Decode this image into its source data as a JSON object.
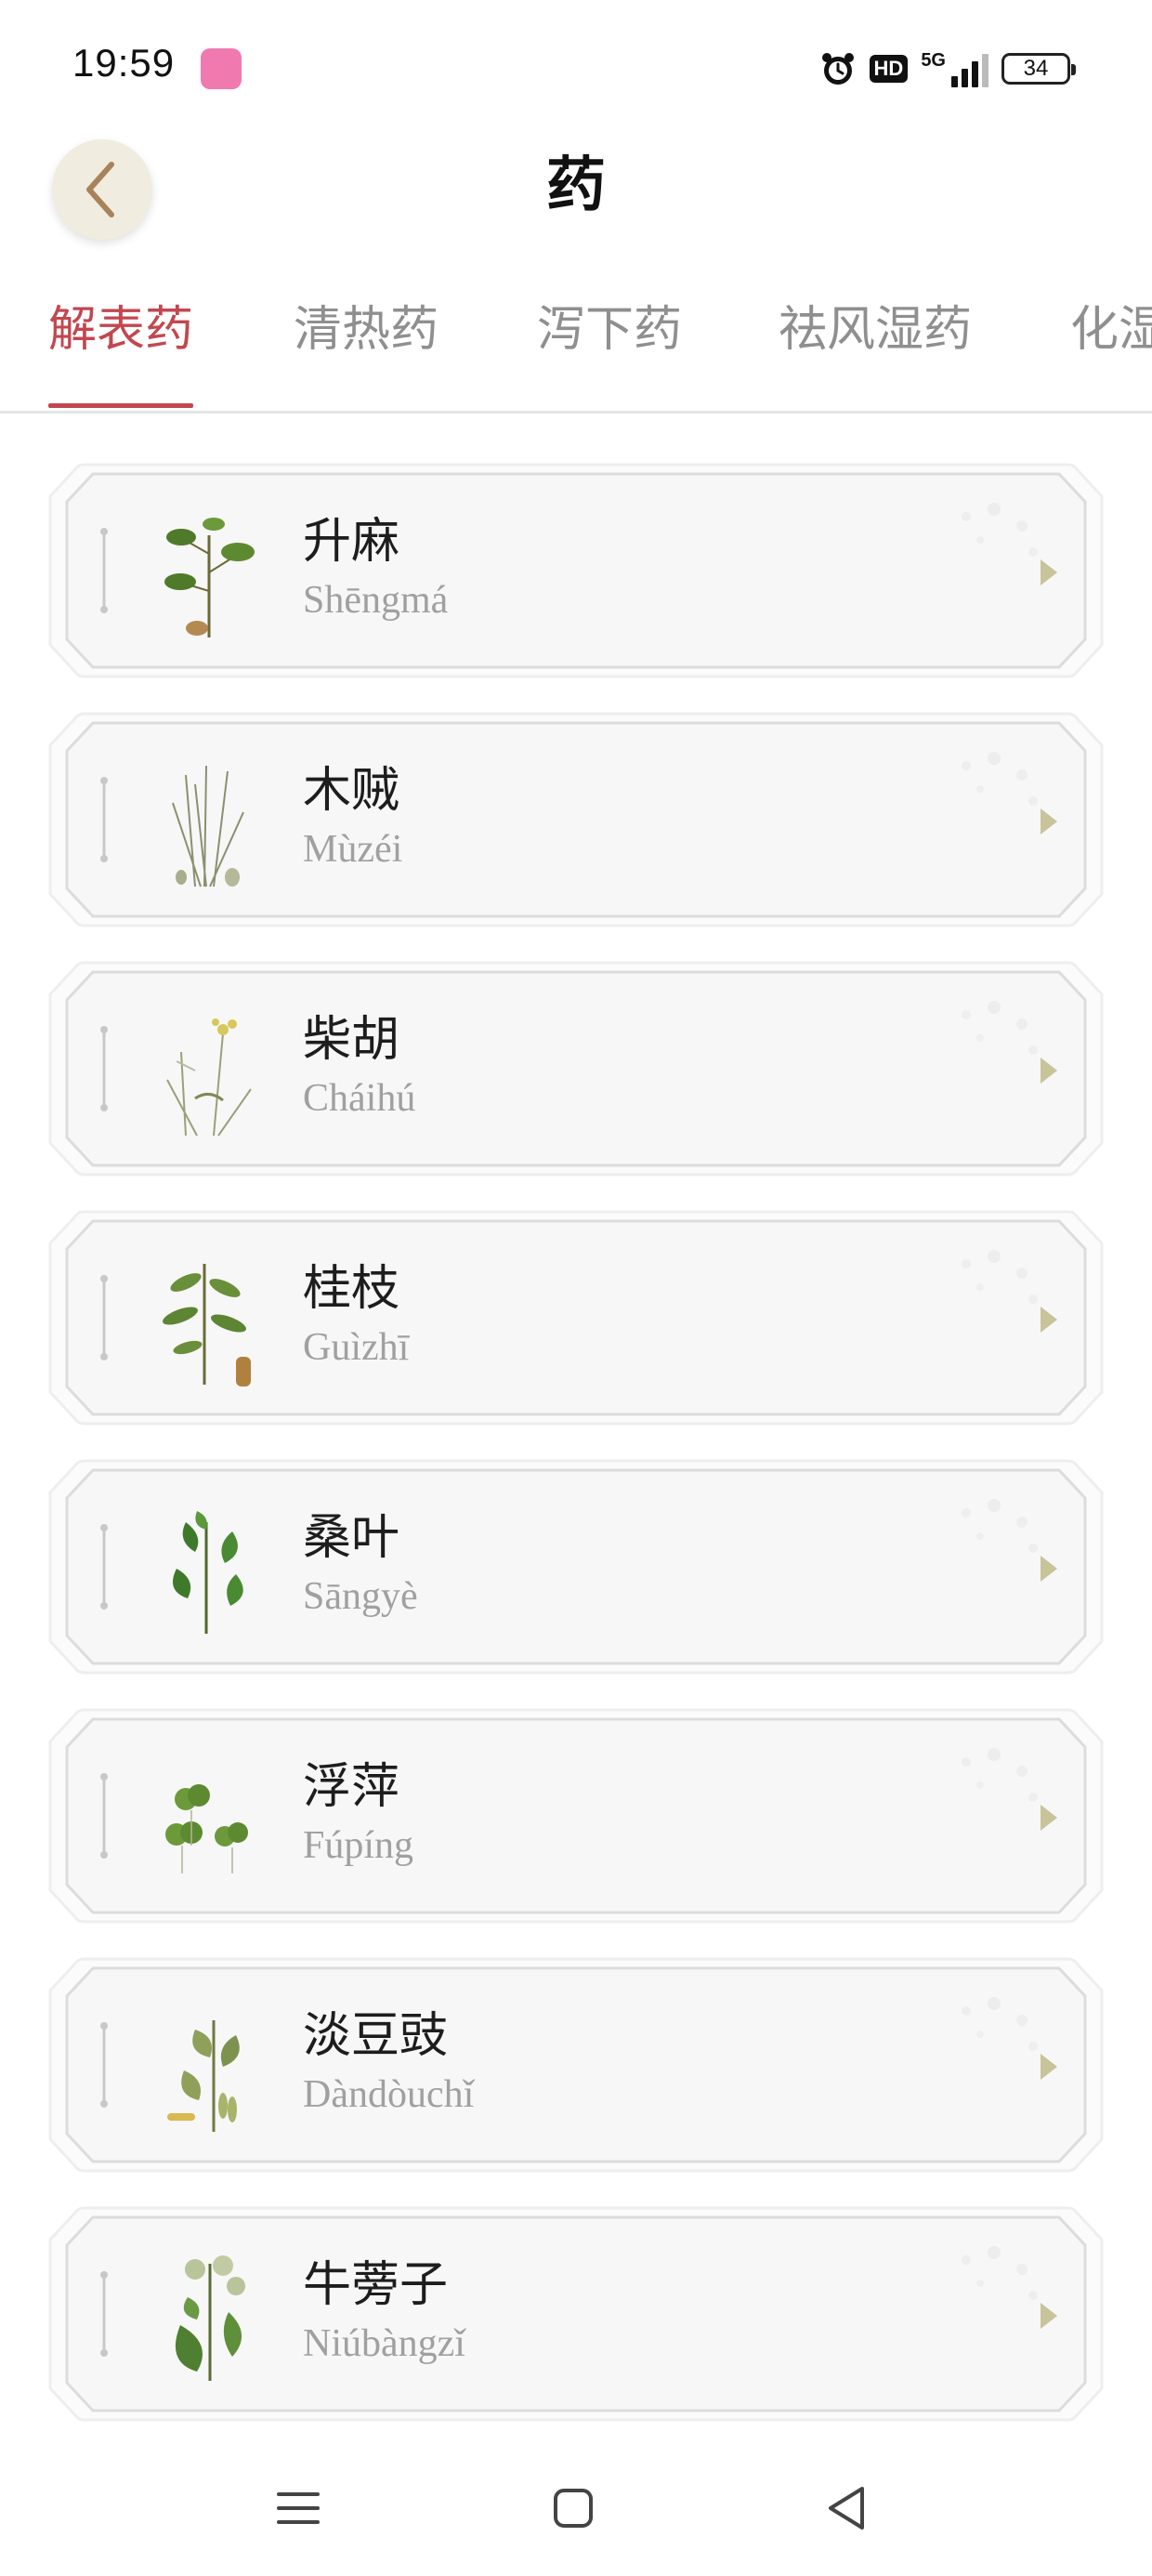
{
  "status_bar": {
    "time": "19:59",
    "hd": "HD",
    "network": "5G",
    "battery": "34"
  },
  "header": {
    "title": "药"
  },
  "tabs": [
    {
      "label": "解表药",
      "active": true
    },
    {
      "label": "清热药",
      "active": false
    },
    {
      "label": "泻下药",
      "active": false
    },
    {
      "label": "祛风湿药",
      "active": false
    },
    {
      "label": "化湿药",
      "active": false
    }
  ],
  "herbs": [
    {
      "name": "升麻",
      "pinyin": "Shēngmá"
    },
    {
      "name": "木贼",
      "pinyin": "Mùzéi"
    },
    {
      "name": "柴胡",
      "pinyin": "Cháihú"
    },
    {
      "name": "桂枝",
      "pinyin": "Guìzhī"
    },
    {
      "name": "桑叶",
      "pinyin": "Sāngyè"
    },
    {
      "name": "浮萍",
      "pinyin": "Fúpíng"
    },
    {
      "name": "淡豆豉",
      "pinyin": "Dàndòuchǐ"
    },
    {
      "name": "牛蒡子",
      "pinyin": "Niúbàngzǐ"
    }
  ],
  "colors": {
    "accent": "#c2474f",
    "inactive_tab": "#8f8f8f",
    "pinyin": "#a0a0a0",
    "card_border": "#dcdcdc",
    "card_fill": "#f7f7f7",
    "arrow": "#c9c39a"
  },
  "icons": {
    "back": "chevron-left-icon",
    "alarm": "alarm-clock-icon",
    "nav_menu": "menu-icon",
    "nav_home": "square-home-icon",
    "nav_back": "triangle-back-icon"
  }
}
